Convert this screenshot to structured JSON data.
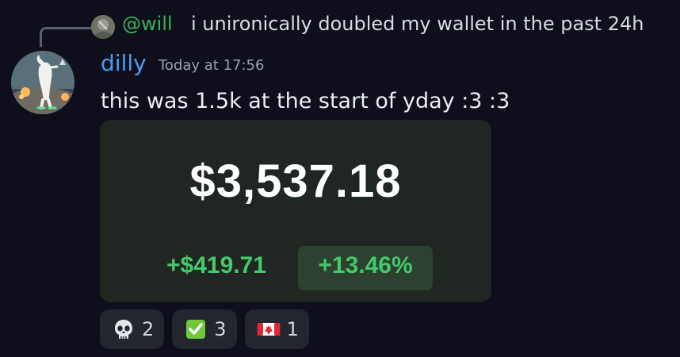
{
  "reply": {
    "user": "@will",
    "text": "i unironically doubled my wallet in the past 24h"
  },
  "message": {
    "author": "dilly",
    "timestamp": "Today at 17:56",
    "text": "this was 1.5k at the start of yday :3 :3"
  },
  "embed": {
    "balance": "$3,537.18",
    "gain_amount": "+$419.71",
    "gain_percent": "+13.46%"
  },
  "reactions": [
    {
      "icon": "skull-icon",
      "count": "2"
    },
    {
      "icon": "check-mark-icon",
      "count": "3"
    },
    {
      "icon": "canada-flag-icon",
      "count": "1"
    }
  ],
  "colors": {
    "background": "#0f0f1c",
    "reply_user": "#39b35a",
    "author": "#4b9bf1",
    "gain": "#45c96b",
    "embed_background": "#202621"
  }
}
